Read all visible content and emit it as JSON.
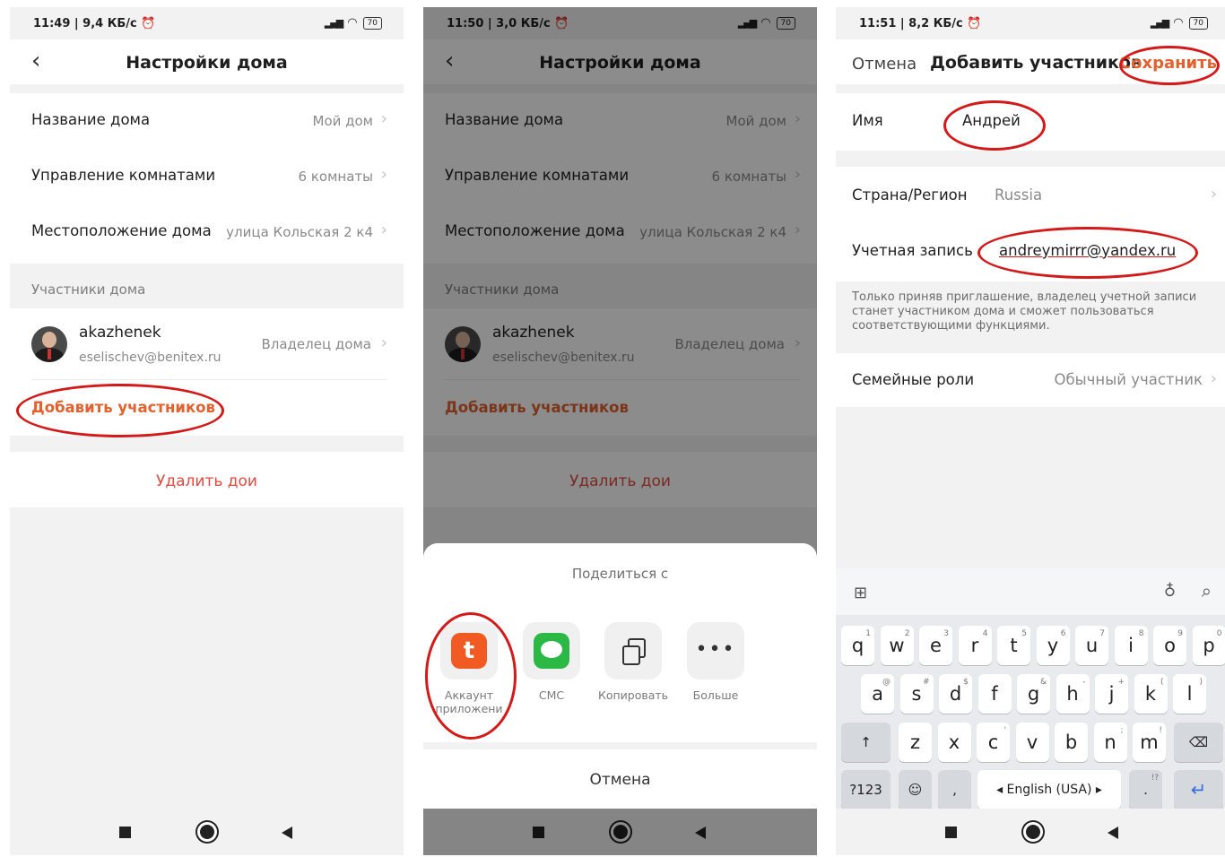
{
  "phone1": {
    "status": {
      "time": "11:49 | 9,4 КБ/с ⏰",
      "battery": "70"
    },
    "title": "Настройки дома",
    "rows": [
      {
        "label": "Название дома",
        "value": "Мой дом"
      },
      {
        "label": "Управление комнатами",
        "value": "6 комнаты"
      },
      {
        "label": "Местоположение дома",
        "value": "улица Кольская 2 к4"
      }
    ],
    "members_title": "Участники дома",
    "member": {
      "name": "akazhenek",
      "email": "eselischev@benitex.ru",
      "role": "Владелец дома"
    },
    "add_members": "Добавить участников",
    "delete_home": "Удалить дои"
  },
  "phone2": {
    "status": {
      "time": "11:50 | 3,0 КБ/с ⏰",
      "battery": "70"
    },
    "title": "Настройки дома",
    "rows": [
      {
        "label": "Название дома",
        "value": "Мой дом"
      },
      {
        "label": "Управление комнатами",
        "value": "6 комнаты"
      },
      {
        "label": "Местоположение дома",
        "value": "улица Кольская 2 к4"
      }
    ],
    "members_title": "Участники дома",
    "member": {
      "name": "akazhenek",
      "email": "eselischev@benitex.ru",
      "role": "Владелец дома"
    },
    "add_members": "Добавить участников",
    "delete_home": "Удалить дои",
    "share": {
      "title": "Поделиться с",
      "options": [
        {
          "label": "Аккаунт приложени",
          "icon": "tuya-app-icon"
        },
        {
          "label": "СМС",
          "icon": "sms-icon"
        },
        {
          "label": "Копировать",
          "icon": "copy-icon"
        },
        {
          "label": "Больше",
          "icon": "more-icon"
        }
      ],
      "cancel": "Отмена"
    }
  },
  "phone3": {
    "status": {
      "time": "11:51 | 8,2 КБ/с ⏰",
      "battery": "70"
    },
    "cancel": "Отмена",
    "title": "Добавить участников",
    "save": "Сохранить",
    "name_label": "Имя",
    "name_value": "Андрей",
    "country_label": "Страна/Регион",
    "country_value": "Russia",
    "account_label": "Учетная запись",
    "account_value": "andreymirrr@yandex.ru",
    "note": "Только приняв приглашение, владелец учетной записи станет участником дома и сможет пользоваться соответствующими функциями.",
    "role_label": "Семейные роли",
    "role_value": "Обычный участник",
    "keyboard": {
      "row1": [
        "q",
        "w",
        "e",
        "r",
        "t",
        "y",
        "u",
        "i",
        "o",
        "p"
      ],
      "row1_hints": [
        "1",
        "2",
        "3",
        "4",
        "5",
        "6",
        "7",
        "8",
        "9",
        "0"
      ],
      "row2": [
        "a",
        "s",
        "d",
        "f",
        "g",
        "h",
        "j",
        "k",
        "l"
      ],
      "row2_hints": [
        "@",
        "#",
        "$",
        "",
        "&",
        "-",
        "+",
        "(",
        ")"
      ],
      "row3": [
        "z",
        "x",
        "c",
        "v",
        "b",
        "n",
        "m"
      ],
      "row3_hints": [
        "",
        "",
        "'",
        "",
        "",
        ";",
        "!",
        "?"
      ],
      "sym": "?123",
      "comma": ",",
      "space": "◂ English (USA) ▸",
      "period": ".",
      "period_hint": "!?"
    }
  },
  "accent": "#e1622e",
  "highlight": "#d41919"
}
